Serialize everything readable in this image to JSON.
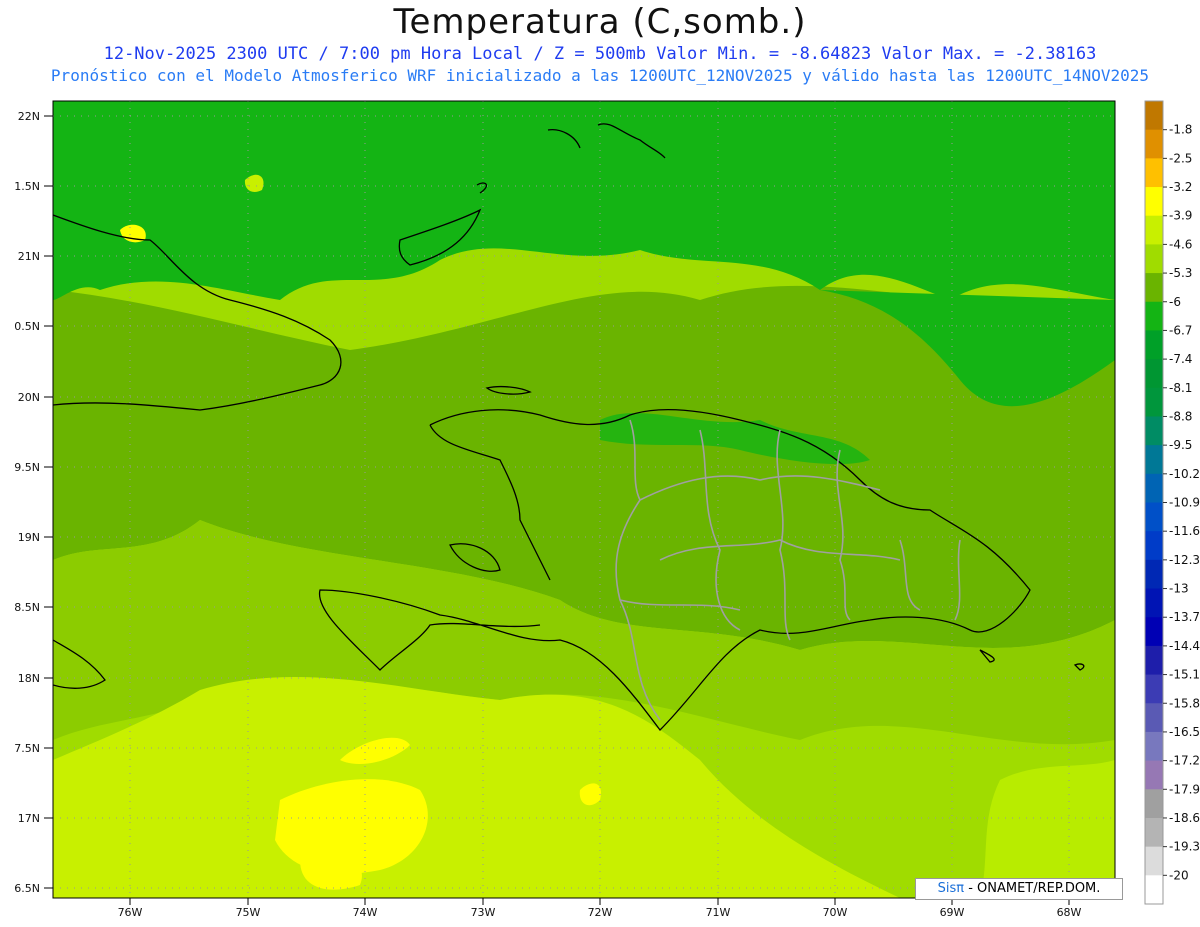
{
  "title": "Temperatura (C,somb.)",
  "subtitle_1": "12-Nov-2025  2300 UTC / 7:00 pm Hora Local / Z = 500mb  Valor Min. = -8.64823  Valor Max. = -2.38163",
  "subtitle_2": "Pronóstico con el Modelo Atmosferico WRF inicializado a las 1200UTC_12NOV2025 y válido hasta las  1200UTC_14NOV2025",
  "credit": {
    "logo": "Sisπ",
    "text": " - ONAMET/REP.DOM."
  },
  "map": {
    "lat_labels": [
      "22N",
      "1.5N",
      "21N",
      "0.5N",
      "20N",
      "9.5N",
      "19N",
      "8.5N",
      "18N",
      "7.5N",
      "17N",
      "6.5N"
    ],
    "lon_labels": [
      "76W",
      "75W",
      "74W",
      "73W",
      "72W",
      "71W",
      "70W",
      "69W",
      "68W"
    ]
  },
  "colorbar": {
    "labels": [
      "-1.8",
      "-2.5",
      "-3.2",
      "-3.9",
      "-4.6",
      "-5.3",
      "-6",
      "-6.7",
      "-7.4",
      "-8.1",
      "-8.8",
      "-9.5",
      "-10.2",
      "-10.9",
      "-11.6",
      "-12.3",
      "-13",
      "-13.7",
      "-14.4",
      "-15.1",
      "-15.8",
      "-16.5",
      "-17.2",
      "-17.9",
      "-18.6",
      "-19.3",
      "-20"
    ],
    "colors": [
      "#c07800",
      "#e09000",
      "#ffc000",
      "#ffff00",
      "#c8f000",
      "#a0dc00",
      "#6ab400",
      "#14b414",
      "#00a028",
      "#009632",
      "#00963c",
      "#008c64",
      "#007896",
      "#0064b4",
      "#0050c8",
      "#003cc8",
      "#0028b4",
      "#0014b4",
      "#0000b4",
      "#1e1eaa",
      "#3c3cb4",
      "#5a5ab4",
      "#7878be",
      "#9678b4",
      "#a0a0a0",
      "#b4b4b4",
      "#dcdcdc",
      "#ffffff"
    ]
  }
}
